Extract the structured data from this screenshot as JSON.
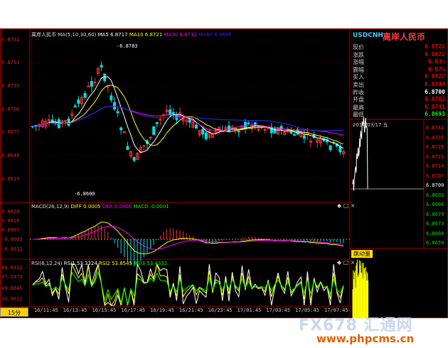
{
  "main_legend": {
    "title": "离岸人民币",
    "ma_label": "MA(5,10,30,60)",
    "ma5": "MA5 6.8717",
    "ma10": "MA10 6.8721",
    "ma30": "MA30 6.8712",
    "ma60": "MA60 6.8686"
  },
  "price_axis": [
    "6.8792",
    "6.8763",
    "6.8735",
    "6.8706",
    "6.8677",
    "6.8648",
    "6.8619"
  ],
  "annotations": {
    "high": "6.8783",
    "low": "6.8600"
  },
  "macd_legend": {
    "label": "MACD(26,12,9)",
    "diff": "DIFF 0.0005",
    "dea": "DEA 0.0006",
    "macd": "MACD -0.0001"
  },
  "macd_axis": [
    "0.0028",
    "0.0016",
    "0.0007",
    "-0.0003",
    "-0.0012"
  ],
  "rsi_legend": {
    "label": "RSI(6,12,24)",
    "rsi1": "RSI1 53.3324",
    "rsi2": "RSI2 53.8545",
    "rsi3": "RSI3 53.4332"
  },
  "rsi_axis": [
    "84.6912",
    "67.2473",
    "49.6845",
    "31.9612"
  ],
  "time_axis": [
    "16/11:45",
    "16/13:45",
    "16/15:45",
    "16/17:45",
    "16/19:45",
    "16/21:45",
    "16/23:45",
    "17/01:45",
    "17/03:45",
    "17/05:45",
    "17/07:45"
  ],
  "period_button": "15分",
  "quote": {
    "symbol": "USDCNH",
    "name": "离岸人民币",
    "rows": [
      {
        "label": "现价",
        "value": "6.8722"
      },
      {
        "label": "涨跌",
        "value": "0.0022"
      },
      {
        "label": "涨幅",
        "value": "0.03%"
      },
      {
        "label": "震幅",
        "value": "0.07%"
      },
      {
        "label": "买入",
        "value": "6.8722"
      },
      {
        "label": "卖出",
        "value": "6.8744"
      },
      {
        "label": "昨收",
        "value": "6.8700"
      },
      {
        "label": "开盘",
        "value": "6.8702"
      },
      {
        "label": "最高",
        "value": "6.8741"
      },
      {
        "label": "最低",
        "value": "6.8693"
      }
    ]
  },
  "intraday": {
    "date": "2017/03/17",
    "weekday": "五",
    "axis": [
      "6.8741",
      "6.8735",
      "6.8728",
      "6.8721",
      "6.8714",
      "6.8707",
      "6.8700",
      "6.8693",
      "6.8686",
      "6.8679",
      "6.8673",
      "6.8666",
      "6.8659"
    ]
  },
  "tick_panel": {
    "title": "跳动量"
  },
  "panel_controls": "◆ □ ×",
  "watermark": "FX678 汇通网",
  "watermark_url": "www.phpcms.cn",
  "colors": {
    "up": "#ff3030",
    "down": "#00e0e0",
    "ma5": "#ffffff",
    "ma10": "#ffff00",
    "ma30": "#ff00ff",
    "ma60": "#00ff00",
    "axis": "#c00000"
  }
}
